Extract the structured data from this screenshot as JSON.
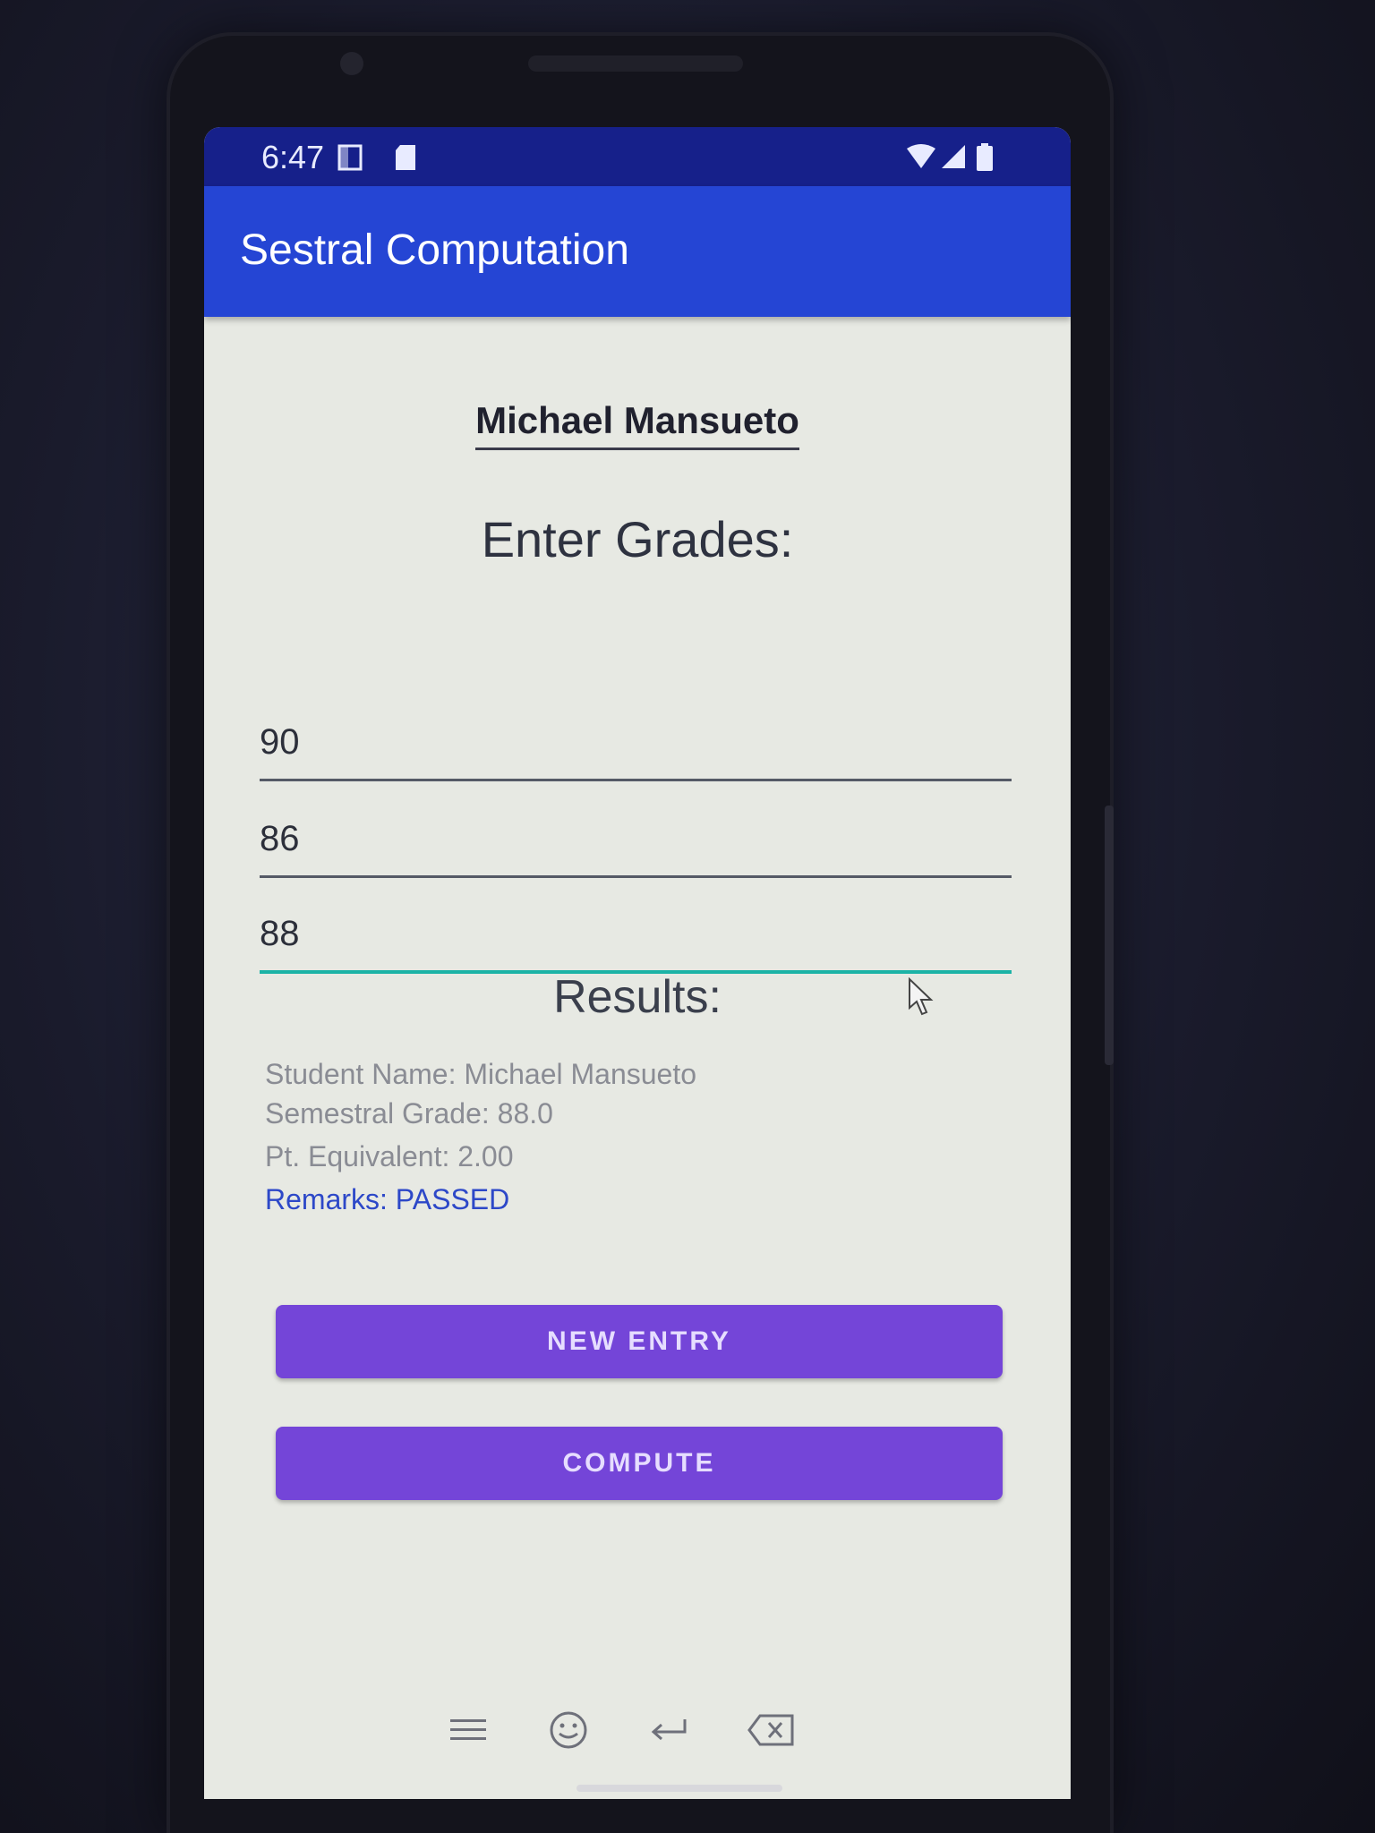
{
  "status_bar": {
    "time": "6:47"
  },
  "app_bar": {
    "title": "Sestral Computation"
  },
  "student": {
    "name": "Michael Mansueto"
  },
  "grades_section": {
    "heading": "Enter Grades:",
    "inputs": [
      "90",
      "86",
      "88"
    ]
  },
  "results": {
    "heading": "Results:",
    "student_name_line": "Student Name: Michael Mansueto",
    "semestral_grade_line": "Semestral Grade: 88.0",
    "pt_equivalent_line": "Pt. Equivalent: 2.00",
    "remarks_line": "Remarks: PASSED"
  },
  "buttons": {
    "new_entry": "NEW ENTRY",
    "compute": "COMPUTE"
  },
  "keyboard_toolbar": {
    "icons": [
      "menu-icon",
      "emoji-icon",
      "enter-icon",
      "backspace-icon"
    ]
  },
  "colors": {
    "status_bar": "#16208a",
    "app_bar": "#2545d4",
    "button": "#7445d8",
    "remarks": "#2d48c8",
    "input_active": "#1bb3a6"
  }
}
